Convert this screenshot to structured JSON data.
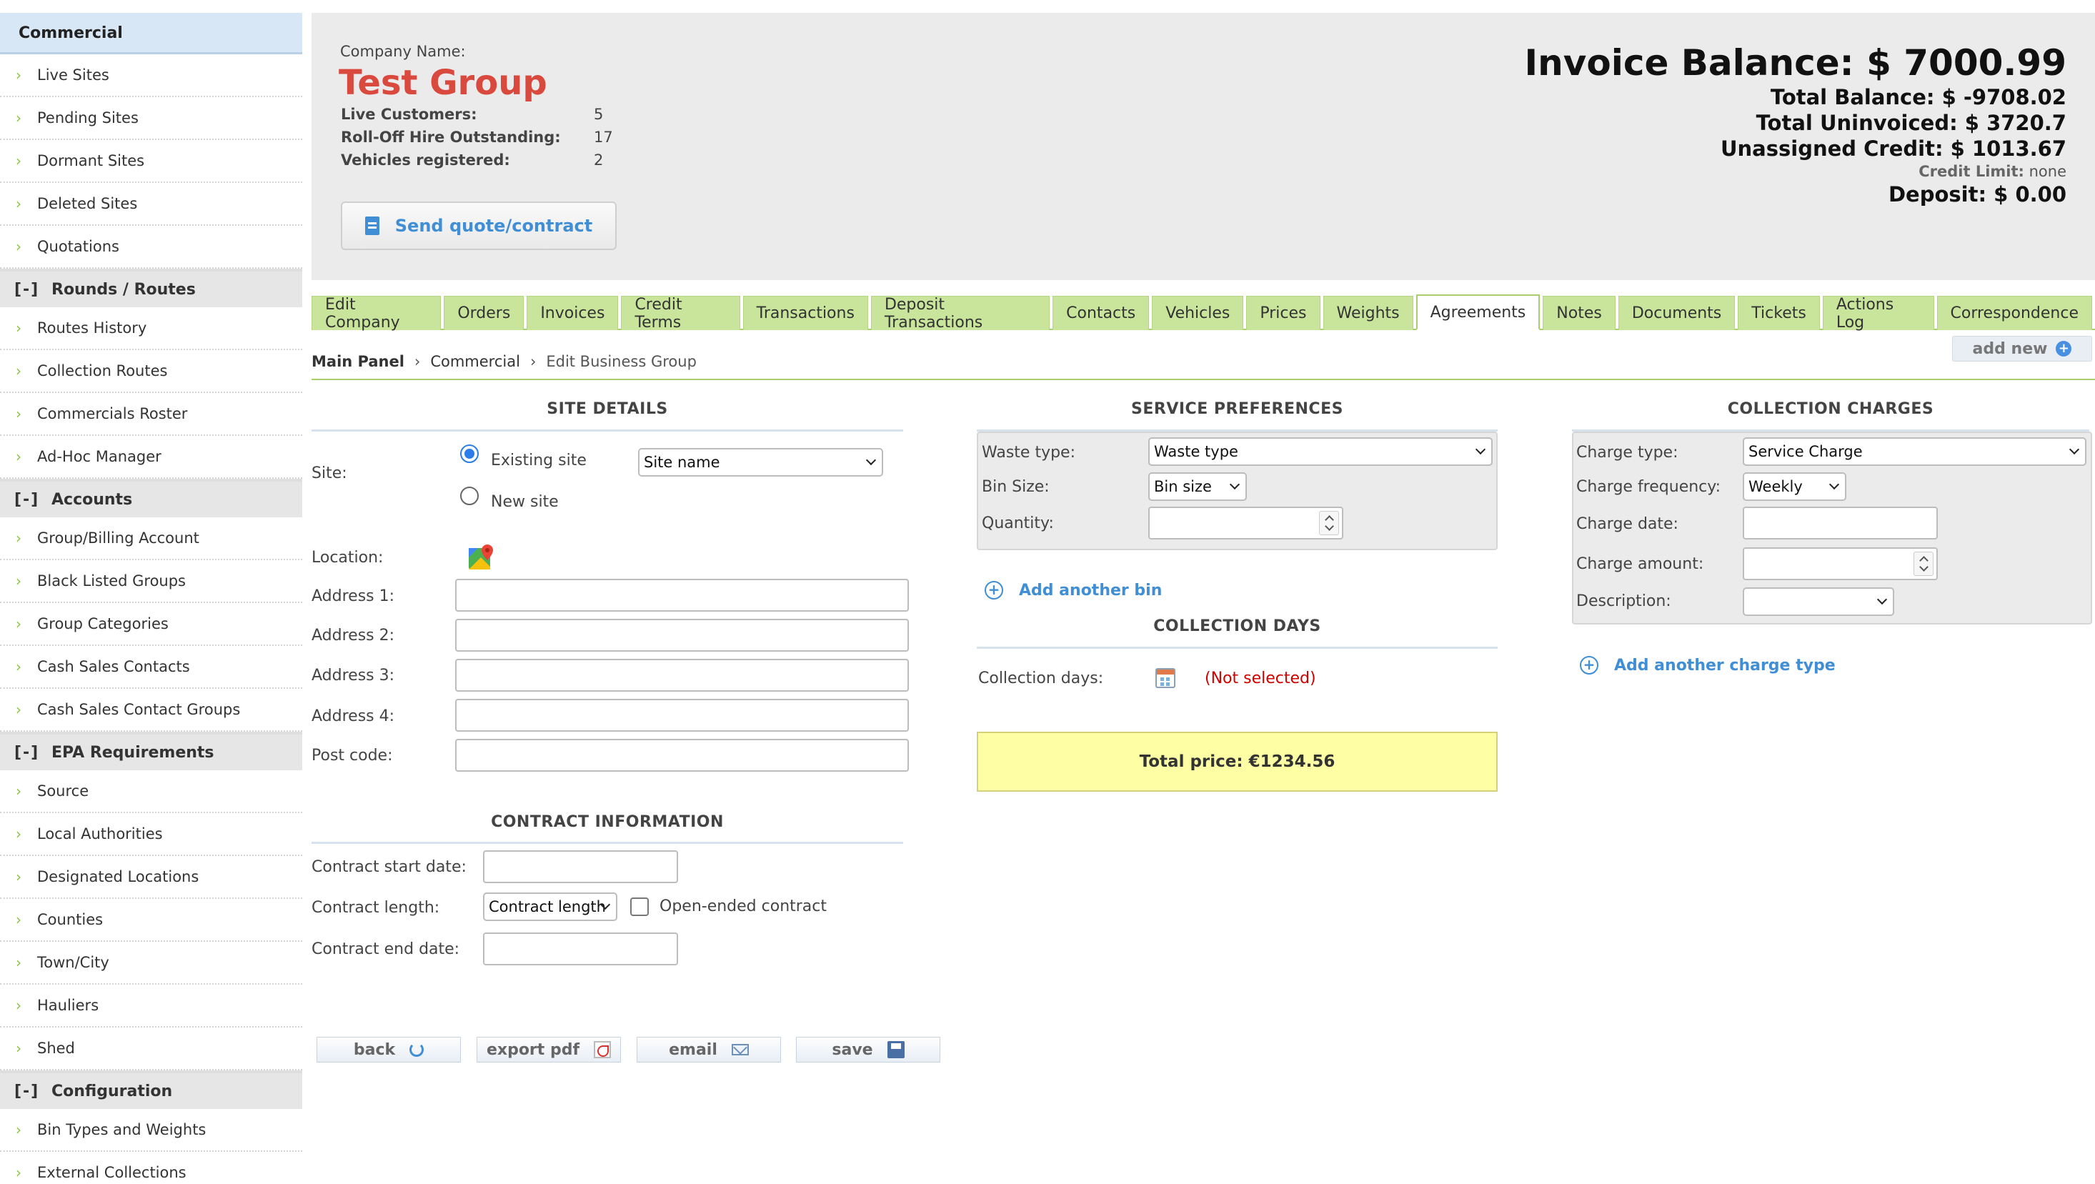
{
  "sidebar": {
    "top_header": "Commercial",
    "top_items": [
      "Live Sites",
      "Pending Sites",
      "Dormant Sites",
      "Deleted Sites",
      "Quotations"
    ],
    "groups": [
      {
        "toggle": "[-]",
        "title": "Rounds / Routes",
        "items": [
          "Routes History",
          "Collection Routes",
          "Commercials Roster",
          "Ad-Hoc Manager"
        ]
      },
      {
        "toggle": "[-]",
        "title": "Accounts",
        "items": [
          "Group/Billing Account",
          "Black Listed Groups",
          "Group Categories",
          "Cash Sales Contacts",
          "Cash Sales Contact Groups"
        ]
      },
      {
        "toggle": "[-]",
        "title": "EPA Requirements",
        "items": [
          "Source",
          "Local Authorities",
          "Designated Locations",
          "Counties",
          "Town/City",
          "Hauliers",
          "Shed"
        ]
      },
      {
        "toggle": "[-]",
        "title": "Configuration",
        "items": [
          "Bin Types and Weights",
          "External Collections"
        ]
      }
    ],
    "chevron": "›"
  },
  "header": {
    "company_label": "Company Name:",
    "company_name": "Test Group",
    "stats": [
      {
        "label": "Live Customers:",
        "value": "5"
      },
      {
        "label": "Roll-Off Hire Outstanding:",
        "value": "17"
      },
      {
        "label": "Vehicles registered:",
        "value": "2"
      }
    ],
    "send_button": "Send quote/contract",
    "invoice_balance": "Invoice Balance: $ 7000.99",
    "total_balance": "Total Balance: $ -9708.02",
    "total_uninvoiced": "Total Uninvoiced: $ 3720.7",
    "unassigned_credit": "Unassigned Credit: $ 1013.67",
    "credit_limit_label": "Credit Limit:",
    "credit_limit_value": "none",
    "deposit": "Deposit: $ 0.00"
  },
  "tabs": [
    "Edit Company",
    "Orders",
    "Invoices",
    "Credit Terms",
    "Transactions",
    "Deposit Transactions",
    "Contacts",
    "Vehicles",
    "Prices",
    "Weights",
    "Agreements",
    "Notes",
    "Documents",
    "Tickets",
    "Actions Log",
    "Correspondence"
  ],
  "active_tab": "Agreements",
  "breadcrumb": {
    "root": "Main Panel",
    "section": "Commercial",
    "page": "Edit Business Group",
    "separator": "›"
  },
  "add_new": {
    "label": "add new",
    "icon": "+"
  },
  "site_details": {
    "title": "SITE DETAILS",
    "site_label": "Site:",
    "existing_site": "Existing site",
    "new_site": "New site",
    "site_select": "Site name",
    "location_label": "Location:",
    "address1_label": "Address 1:",
    "address2_label": "Address 2:",
    "address3_label": "Address 3:",
    "address4_label": "Address 4:",
    "postcode_label": "Post code:"
  },
  "contract_info": {
    "title": "CONTRACT INFORMATION",
    "start_label": "Contract start date:",
    "length_label": "Contract length:",
    "length_select": "Contract length",
    "open_ended_label": "Open-ended contract",
    "end_label": "Contract end date:"
  },
  "service_prefs": {
    "title": "SERVICE PREFERENCES",
    "waste_type_label": "Waste type:",
    "waste_type_select": "Waste type",
    "bin_size_label": "Bin Size:",
    "bin_size_select": "Bin size",
    "quantity_label": "Quantity:",
    "add_bin": "Add another bin",
    "add_icon": "+"
  },
  "collection_days": {
    "title": "COLLECTION DAYS",
    "label": "Collection days:",
    "value": "(Not selected)",
    "total_price": "Total price: €1234.56"
  },
  "collection_charges": {
    "title": "COLLECTION CHARGES",
    "charge_type_label": "Charge type:",
    "charge_type_select": "Service Charge",
    "frequency_label": "Charge frequency:",
    "frequency_select": "Weekly",
    "date_label": "Charge date:",
    "amount_label": "Charge amount:",
    "description_label": "Description:",
    "description_select": "",
    "add_charge": "Add another charge type",
    "add_icon": "+"
  },
  "buttons": {
    "back": "back",
    "export_pdf": "export pdf",
    "email": "email",
    "save": "save"
  },
  "colors": {
    "accent_green": "#c9e59c",
    "brand_red": "#d9493e",
    "link_blue": "#3f8ed6",
    "warning_red": "#d10000",
    "total_yellow": "#fefea4"
  }
}
